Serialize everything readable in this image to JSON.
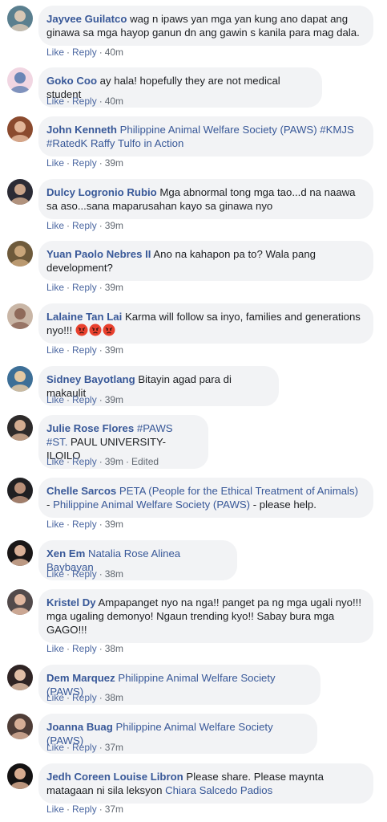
{
  "actions": {
    "like": "Like",
    "reply": "Reply",
    "edited": "Edited"
  },
  "comments": [
    {
      "author": "Jayvee Guilatco",
      "parts": [
        {
          "text": " wag n ipaws yan mga yan kung ano dapat ang ginawa sa mga hayop ganun dn ang gawin s kanila para mag dala.",
          "tag": false
        }
      ],
      "time": "40m"
    },
    {
      "author": "Goko Coo",
      "parts": [
        {
          "text": " ay hala! hopefully they are not medical student",
          "tag": false
        }
      ],
      "time": "40m"
    },
    {
      "author": "John Kenneth",
      "parts": [
        {
          "text": " Philippine Animal Welfare Society (PAWS) #KMJS #RatedK Raffy Tulfo in Action",
          "tag": true
        }
      ],
      "time": "39m"
    },
    {
      "author": "Dulcy Logronio Rubio",
      "parts": [
        {
          "text": " Mga abnormal tong mga tao...d na naawa sa aso...sana maparusahan kayo sa ginawa nyo",
          "tag": false
        }
      ],
      "time": "39m"
    },
    {
      "author": "Yuan Paolo Nebres II",
      "parts": [
        {
          "text": " Ano na kahapon pa to? Wala pang development?",
          "tag": false
        }
      ],
      "time": "39m"
    },
    {
      "author": "Lalaine Tan Lai",
      "parts": [
        {
          "text": " Karma will follow sa inyo, families and generations nyo!!! ",
          "tag": false
        }
      ],
      "emoji": "angry-face",
      "emoji_count": 3,
      "time": "39m"
    },
    {
      "author": "Sidney Bayotlang",
      "parts": [
        {
          "text": " Bitayin agad para di makaulit",
          "tag": false
        }
      ],
      "time": "39m"
    },
    {
      "author": "Julie Rose Flores",
      "parts": [
        {
          "text": " #PAWS",
          "tag": true
        },
        {
          "text": " #ST.",
          "tag": true
        },
        {
          "text": " PAUL UNIVERSITY-ILOILO",
          "tag": false
        }
      ],
      "time": "39m",
      "edited": true
    },
    {
      "author": "Chelle Sarcos",
      "parts": [
        {
          "text": " PETA (People for the Ethical Treatment of Animals)",
          "tag": true
        },
        {
          "text": " - ",
          "tag": false
        },
        {
          "text": "Philippine Animal Welfare Society (PAWS)",
          "tag": true
        },
        {
          "text": " - please help.",
          "tag": false
        }
      ],
      "time": "39m"
    },
    {
      "author": "Xen Em",
      "parts": [
        {
          "text": " Natalia Rose Alinea Baybayan",
          "tag": true
        }
      ],
      "time": "38m"
    },
    {
      "author": "Kristel Dy",
      "parts": [
        {
          "text": " Ampapanget nyo na nga!! panget pa ng mga ugali nyo!!! mga ugaling demonyo! Ngaun trending kyo!! Sabay bura mga GAGO!!!",
          "tag": false
        }
      ],
      "time": "38m"
    },
    {
      "author": "Dem Marquez",
      "parts": [
        {
          "text": " Philippine Animal Welfare Society (PAWS)",
          "tag": true
        }
      ],
      "time": "38m"
    },
    {
      "author": "Joanna Buag",
      "parts": [
        {
          "text": " Philippine Animal Welfare Society (PAWS)",
          "tag": true
        }
      ],
      "time": "37m"
    },
    {
      "author": "Jedh Coreen Louise Libron",
      "parts": [
        {
          "text": " Please share. Please maynta matagaan ni sila leksyon ",
          "tag": false
        },
        {
          "text": "Chiara Salcedo Padios",
          "tag": true
        }
      ],
      "time": "37m"
    }
  ]
}
